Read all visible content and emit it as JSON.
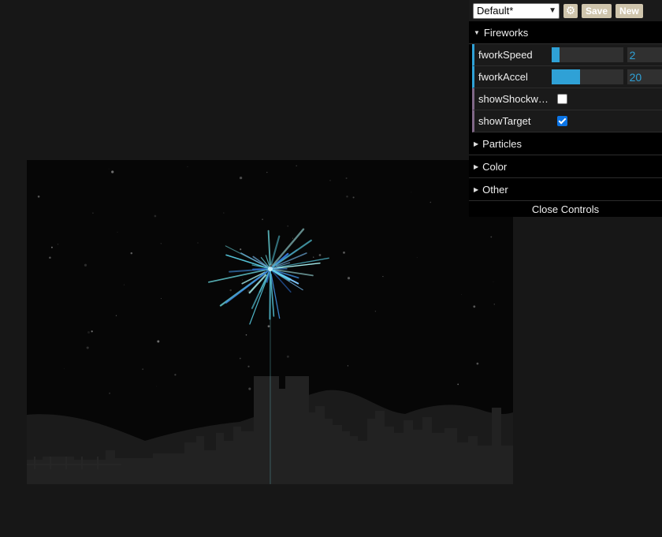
{
  "gui": {
    "preset": "Default*",
    "gear_icon": "gear-icon",
    "save_label": "Save",
    "new_label": "New",
    "folders": {
      "fireworks": {
        "title": "Fireworks",
        "rows": {
          "fworkSpeed": {
            "label": "fworkSpeed",
            "value": "2",
            "fill": 0.11
          },
          "fworkAccel": {
            "label": "fworkAccel",
            "value": "20",
            "fill": 0.4
          },
          "showShockwave": {
            "label": "showShockwa...",
            "checked": false
          },
          "showTarget": {
            "label": "showTarget",
            "checked": true
          }
        }
      },
      "particles": {
        "title": "Particles"
      },
      "color": {
        "title": "Color"
      },
      "other": {
        "title": "Other"
      }
    },
    "close_label": "Close Controls"
  },
  "colors": {
    "number_accent": "#2fa1d6",
    "boolean_accent": "#806787",
    "button_bg": "#cfc5ac",
    "firework": "#5ad0e6"
  }
}
